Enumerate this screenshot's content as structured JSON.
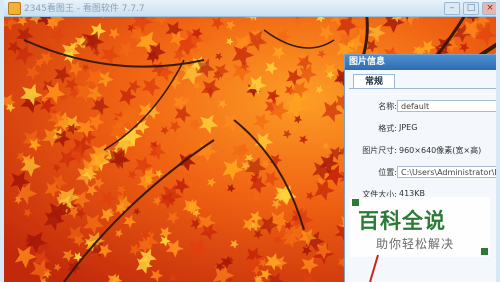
{
  "window": {
    "title": "2345看图王 - 看图软件 7.7.7",
    "buttons": [
      "–",
      "□",
      "×"
    ]
  },
  "panel": {
    "header": "图片信息",
    "tab": "常规",
    "fields": [
      {
        "label": "名称:",
        "value": "default"
      },
      {
        "label": "格式:",
        "value": "JPEG"
      },
      {
        "label": "图片尺寸:",
        "value": "960×640像素(宽×高)"
      },
      {
        "label": "位置:",
        "value": "C:\\Users\\Administrator\\Desk op"
      },
      {
        "label": "文件大小:",
        "value": "413KB"
      }
    ]
  },
  "watermark": {
    "title": "百科全说",
    "subtitle": "助你轻松解决"
  },
  "colors": {
    "panel_header": "#2e6cb0",
    "watermark_green": "#2b7a36",
    "foliage_red": "#e04010",
    "foliage_orange": "#f28a1a"
  },
  "photo": {
    "subject": "autumn-maple-leaves"
  }
}
